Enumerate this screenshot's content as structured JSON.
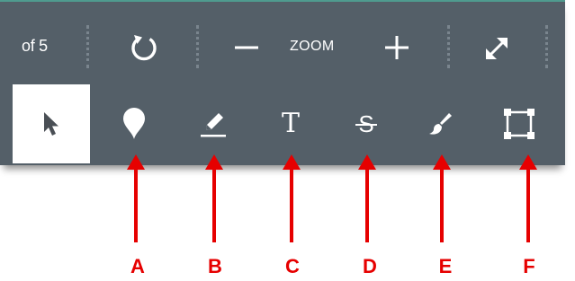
{
  "toolbar": {
    "page_info": "of 5",
    "zoom_label": "ZOOM",
    "colors": {
      "background": "#545f68",
      "active_tool_background": "#ffffff",
      "icon": "#ffffff",
      "annotation": "#e60000"
    },
    "top_buttons": [
      {
        "name": "rotate",
        "icon": "rotate-icon"
      },
      {
        "name": "zoom-out",
        "icon": "minus-icon"
      },
      {
        "name": "zoom-in",
        "icon": "plus-icon"
      },
      {
        "name": "fullscreen",
        "icon": "expand-icon"
      }
    ],
    "tools": [
      {
        "name": "select",
        "icon": "cursor-arrow-icon",
        "active": true
      },
      {
        "name": "pin",
        "icon": "map-pin-icon",
        "active": false
      },
      {
        "name": "highlight",
        "icon": "pencil-underline-icon",
        "active": false
      },
      {
        "name": "text",
        "icon": "text-icon",
        "glyph": "T",
        "active": false
      },
      {
        "name": "strikethrough",
        "icon": "strikethrough-icon",
        "glyph": "S",
        "active": false
      },
      {
        "name": "draw",
        "icon": "brush-icon",
        "active": false
      },
      {
        "name": "area",
        "icon": "square-selection-icon",
        "active": false
      }
    ]
  },
  "callouts": {
    "labels": [
      "A",
      "B",
      "C",
      "D",
      "E",
      "F"
    ]
  }
}
